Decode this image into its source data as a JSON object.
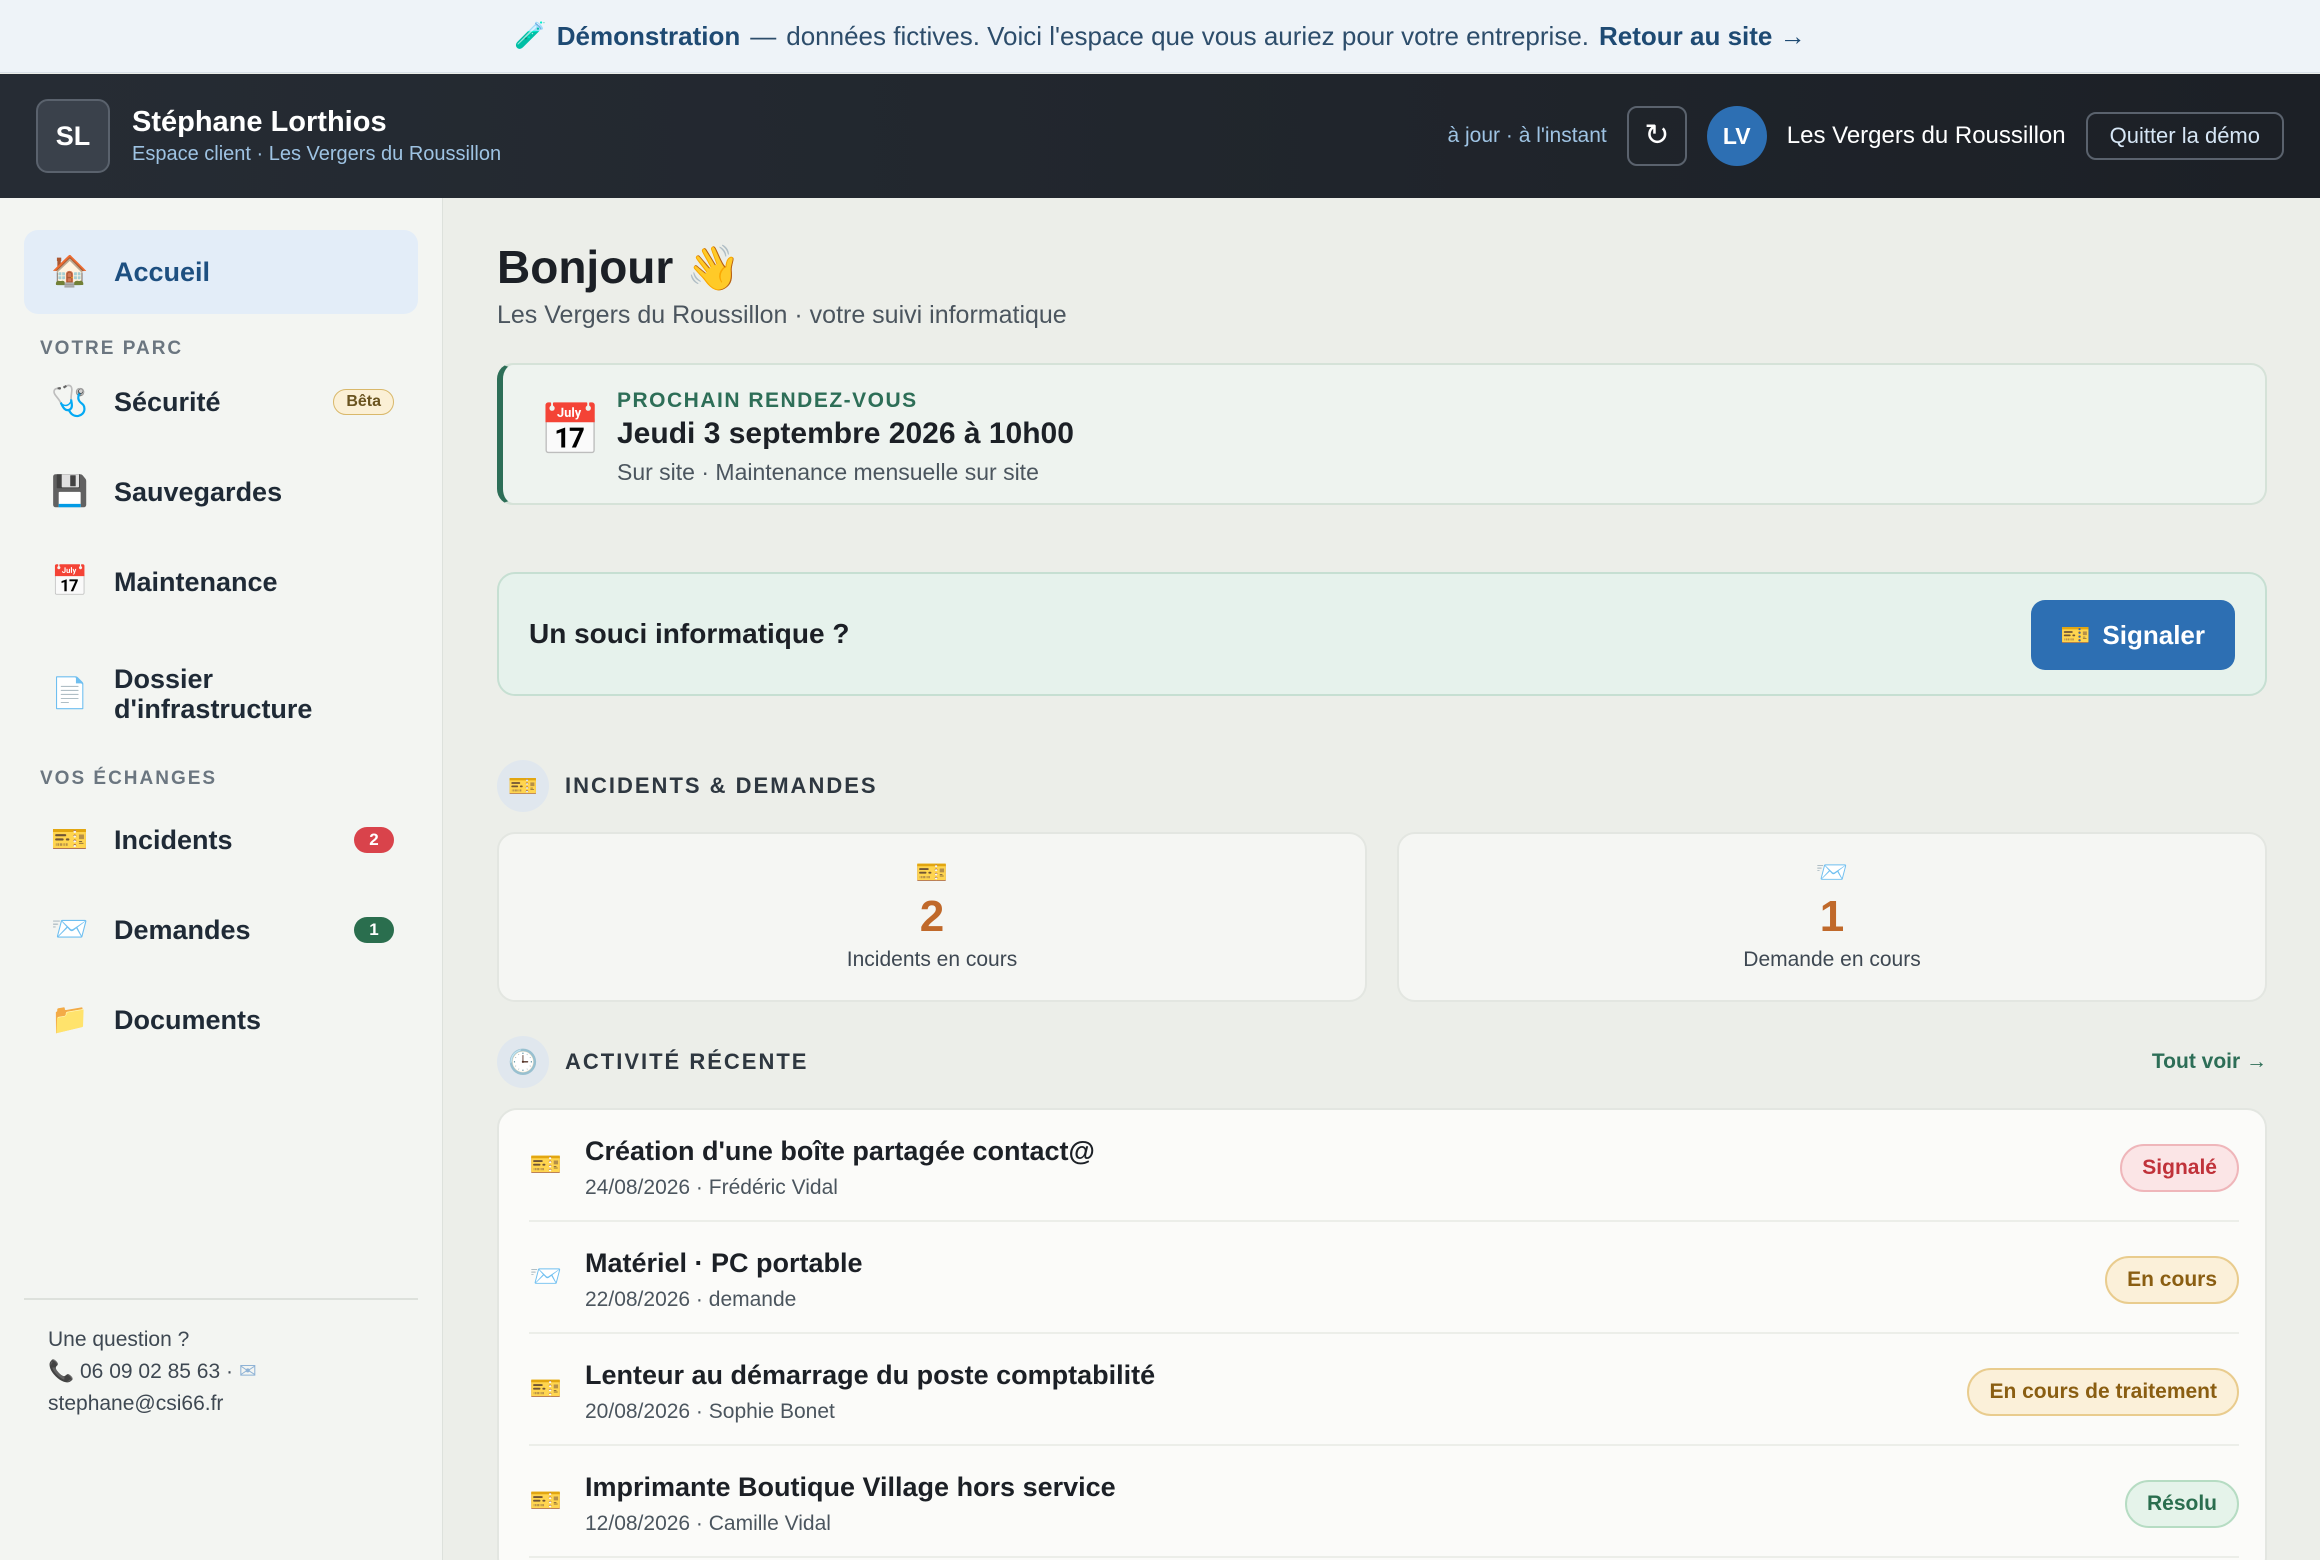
{
  "banner": {
    "icon": "test-tube-icon",
    "bold": "Démonstration",
    "dash": "—",
    "text": "données fictives. Voici l'espace que vous auriez pour votre entreprise.",
    "link": "Retour au site →"
  },
  "header": {
    "initials": "SL",
    "user_name": "Stéphane Lorthios",
    "user_sub": "Espace client · Les Vergers du Roussillon",
    "sync_status": "à jour · à l'instant",
    "refresh_glyph": "↻",
    "company_initials": "LV",
    "company_name": "Les Vergers du Roussillon",
    "quit_label": "Quitter la démo"
  },
  "sidebar": {
    "home": {
      "icon": "house-icon",
      "glyph": "🏠",
      "label": "Accueil"
    },
    "section_parc": "VOTRE PARC",
    "parc_items": [
      {
        "icon": "stethoscope-icon",
        "glyph": "🩺",
        "label": "Sécurité",
        "badge": "Bêta"
      },
      {
        "icon": "floppy-disk-icon",
        "glyph": "💾",
        "label": "Sauvegardes"
      },
      {
        "icon": "calendar-icon",
        "glyph": "📅",
        "label": "Maintenance"
      },
      {
        "icon": "document-icon",
        "glyph": "📄",
        "label_line1": "Dossier",
        "label_line2": "d'infrastructure"
      }
    ],
    "section_echanges": "VOS ÉCHANGES",
    "echange_items": [
      {
        "icon": "ticket-icon",
        "glyph": "🎫",
        "label": "Incidents",
        "count": "2"
      },
      {
        "icon": "envelope-icon",
        "glyph": "📨",
        "label": "Demandes",
        "count": "1"
      },
      {
        "icon": "folder-icon",
        "glyph": "📁",
        "label": "Documents"
      }
    ],
    "contact": {
      "question": "Une question ?",
      "phone_glyph": "📞",
      "phone": "06 09 02 85 63 ·",
      "mail_glyph": "✉",
      "email": "stephane@csi66.fr"
    }
  },
  "main": {
    "greeting": "Bonjour",
    "greeting_glyph": "👋",
    "greeting_sub": "Les Vergers du Roussillon · votre suivi informatique",
    "rdv": {
      "icon": "calendar-icon",
      "glyph": "📅",
      "kicker": "PROCHAIN RENDEZ-VOUS",
      "title": "Jeudi 3 septembre 2026 à 10h00",
      "sub": "Sur site · Maintenance mensuelle sur site"
    },
    "issue": {
      "text": "Un souci informatique ?",
      "button_glyph": "🎫",
      "button_label": "Signaler"
    },
    "incidents_section": {
      "glyph": "🎫",
      "title": "INCIDENTS & DEMANDES",
      "stats": [
        {
          "icon": "ticket-icon",
          "glyph": "🎫",
          "value": "2",
          "label": "Incidents en cours"
        },
        {
          "icon": "envelope-icon",
          "glyph": "📨",
          "value": "1",
          "label": "Demande en cours"
        }
      ]
    },
    "activity_section": {
      "glyph": "🕒",
      "title": "ACTIVITÉ RÉCENTE",
      "see_all": "Tout voir →",
      "rows": [
        {
          "icon": "ticket-icon",
          "glyph": "🎫",
          "title": "Création d'une boîte partagée contact@",
          "meta": "24/08/2026 · Frédéric Vidal",
          "status": "Signalé",
          "status_color": "#c0323a"
        },
        {
          "icon": "envelope-icon",
          "glyph": "📨",
          "title": "Matériel · PC portable",
          "meta": "22/08/2026 · demande",
          "status": "En cours",
          "status_color": "#8a5e12"
        },
        {
          "icon": "ticket-icon",
          "glyph": "🎫",
          "title": "Lenteur au démarrage du poste comptabilité",
          "meta": "20/08/2026 · Sophie Bonet",
          "status": "En cours de traitement",
          "status_color": "#8a5e12"
        },
        {
          "icon": "ticket-icon",
          "glyph": "🎫",
          "title": "Imprimante Boutique Village hors service",
          "meta": "12/08/2026 · Camille Vidal",
          "status": "Résolu",
          "status_color": "#2a6e4e"
        }
      ]
    }
  },
  "colors": {
    "accent_blue": "#2d6fb3",
    "accent_green": "#2d6e57",
    "header_bg": "#1c2026",
    "count_orange": "#c0692a"
  }
}
